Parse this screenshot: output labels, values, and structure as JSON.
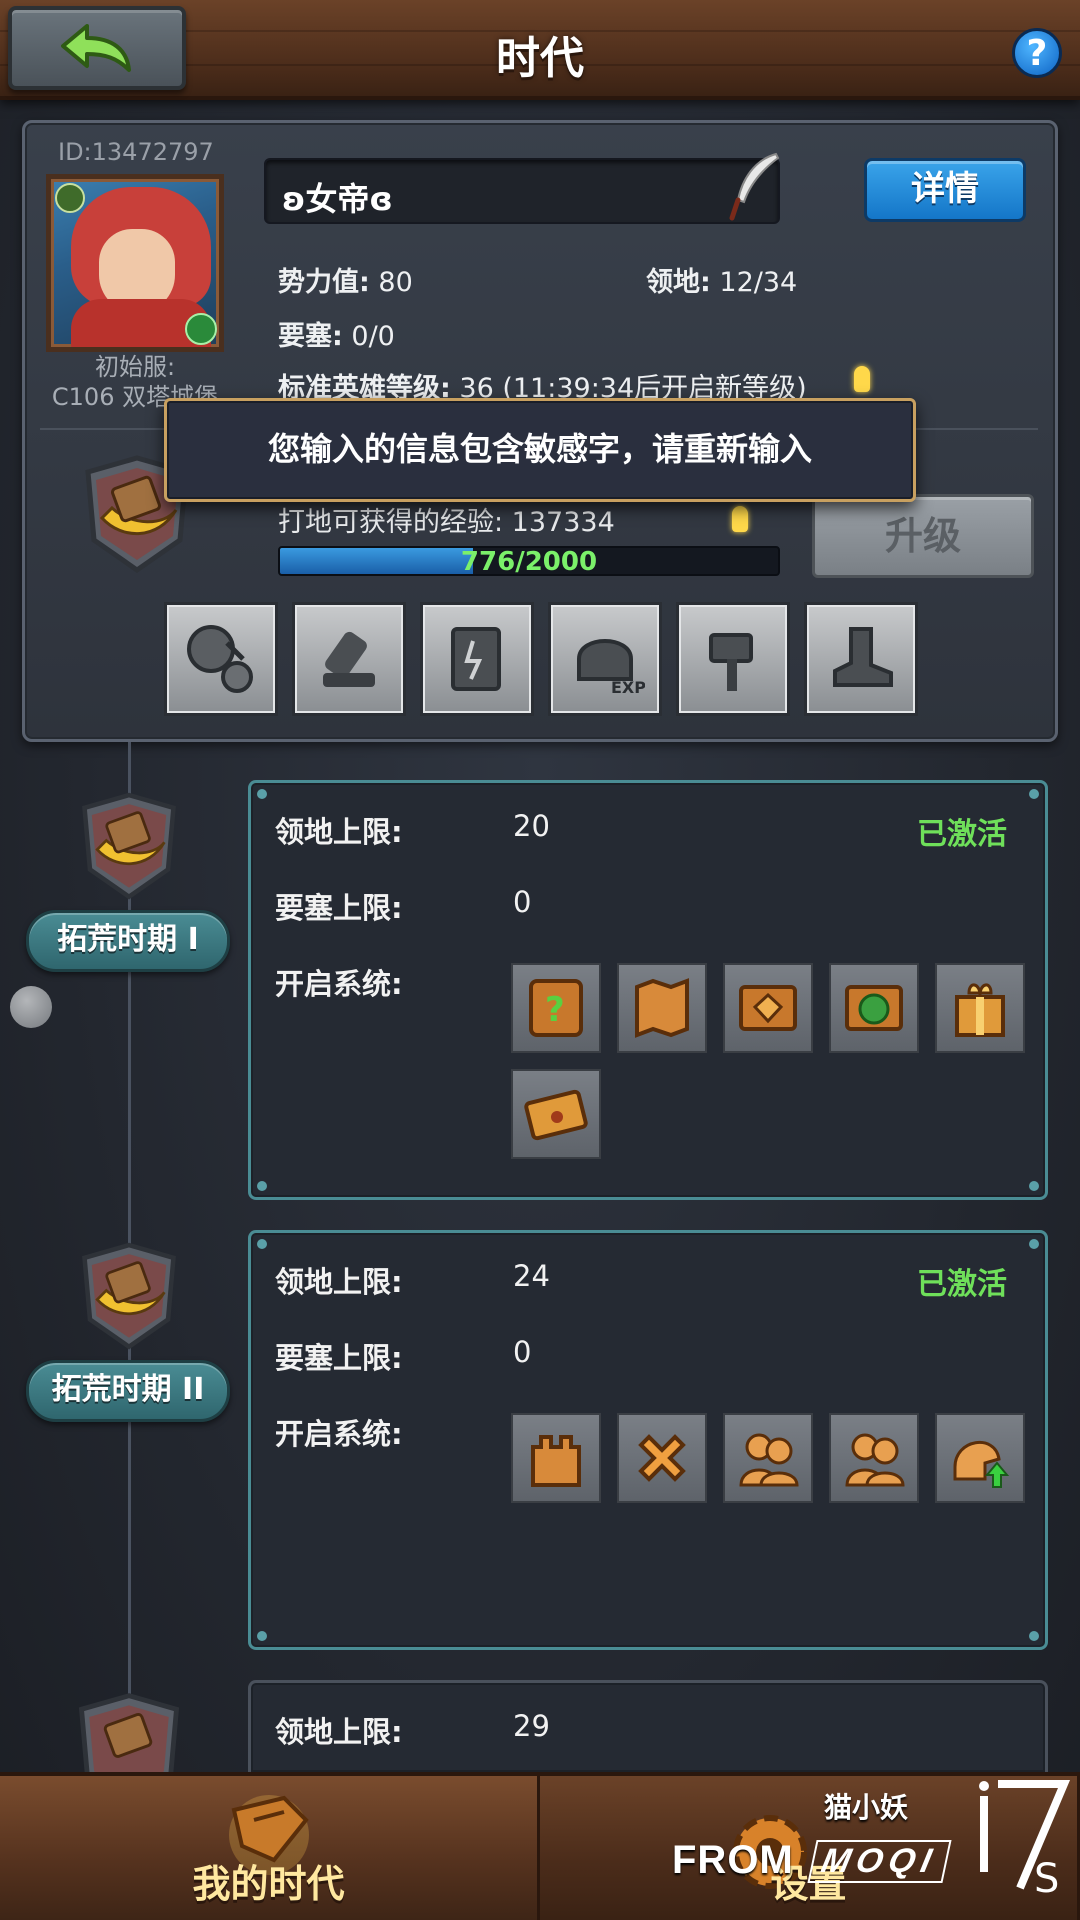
{
  "header": {
    "title": "时代",
    "back": "back-arrow-icon",
    "help": "?"
  },
  "profile": {
    "id_text": "ID:13472797",
    "server_line1": "初始服:",
    "server_line2": "C106 双塔城堡",
    "name": "ʚ女帝ɞ",
    "detail_button": "详情",
    "power_label": "势力值:",
    "power_value": "80",
    "territory_label": "领地:",
    "territory_value": "12/34",
    "fortress_label": "要塞:",
    "fortress_value": "0/0",
    "hero_level_label": "标准英雄等级:",
    "hero_level_value": "36 (11:39:34后开启新等级)",
    "exp_text": "打地可获得的经验: 137334",
    "progress_text": "776/2000",
    "progress_fraction": 0.388,
    "upgrade_button": "升级",
    "system_icons": [
      "coin-exchange-icon",
      "cannon-icon",
      "spellbook-icon",
      "helmet-exp-icon",
      "hammer-icon",
      "boot-icon"
    ]
  },
  "toast": {
    "message": "您输入的信息包含敏感字，请重新输入"
  },
  "eras": [
    {
      "tag": "拓荒时期 I",
      "territory_label": "领地上限:",
      "territory_value": "20",
      "fortress_label": "要塞上限:",
      "fortress_value": "0",
      "unlock_label": "开启系统:",
      "status": "已激活",
      "icons": [
        "quest-scroll-icon",
        "map-icon",
        "gem-scroll-icon",
        "money-bag-icon",
        "gift-box-icon",
        "envelope-icon"
      ]
    },
    {
      "tag": "拓荒时期 II",
      "territory_label": "领地上限:",
      "territory_value": "24",
      "fortress_label": "要塞上限:",
      "fortress_value": "0",
      "unlock_label": "开启系统:",
      "status": "已激活",
      "icons": [
        "fortress-icon",
        "cross-icon",
        "heroes-icon",
        "heroes-pair-icon",
        "helmet-upgrade-icon"
      ]
    },
    {
      "territory_label": "领地上限:",
      "territory_value": "29"
    }
  ],
  "nav": {
    "tab1": "我的时代",
    "tab2": "设置"
  },
  "watermark": {
    "from": "FROM",
    "brand": "MOQI",
    "author": "猫小妖",
    "logo": "i7s"
  },
  "colors": {
    "active_green": "#6fe05a",
    "progress_text": "#7bf06a",
    "detail_blue": "#1476c8",
    "teal_border": "#4a8c94"
  }
}
